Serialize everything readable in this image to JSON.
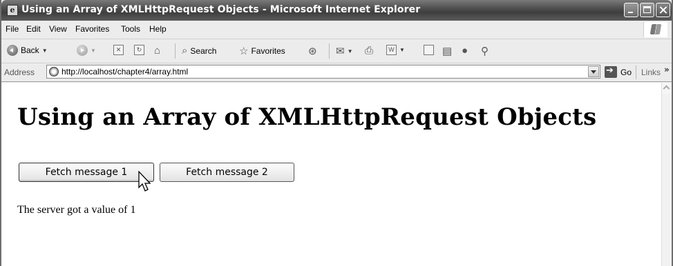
{
  "window": {
    "title": "Using an Array of XMLHttpRequest Objects - Microsoft Internet Explorer"
  },
  "menubar": {
    "items": [
      "File",
      "Edit",
      "View",
      "Favorites",
      "Tools",
      "Help"
    ]
  },
  "toolbar": {
    "back_label": "Back",
    "search_label": "Search",
    "favorites_label": "Favorites"
  },
  "address": {
    "label": "Address",
    "url": "http://localhost/chapter4/array.html",
    "go_label": "Go",
    "links_label": "Links",
    "links_chevron": "»"
  },
  "page": {
    "heading": "Using an Array of XMLHttpRequest Objects",
    "button1": "Fetch message 1",
    "button2": "Fetch message 2",
    "result": "The server got a value of 1"
  },
  "icons": [
    "ie-page-icon",
    "minimize-icon",
    "maximize-icon",
    "close-icon",
    "windows-logo-icon",
    "back-icon",
    "forward-icon",
    "stop-icon",
    "refresh-icon",
    "home-icon",
    "search-icon",
    "favorites-star-icon",
    "history-icon",
    "mail-icon",
    "print-icon",
    "edit-icon",
    "discuss-icon",
    "research-icon",
    "messenger-icon",
    "go-arrow-icon",
    "mouse-cursor-icon"
  ]
}
